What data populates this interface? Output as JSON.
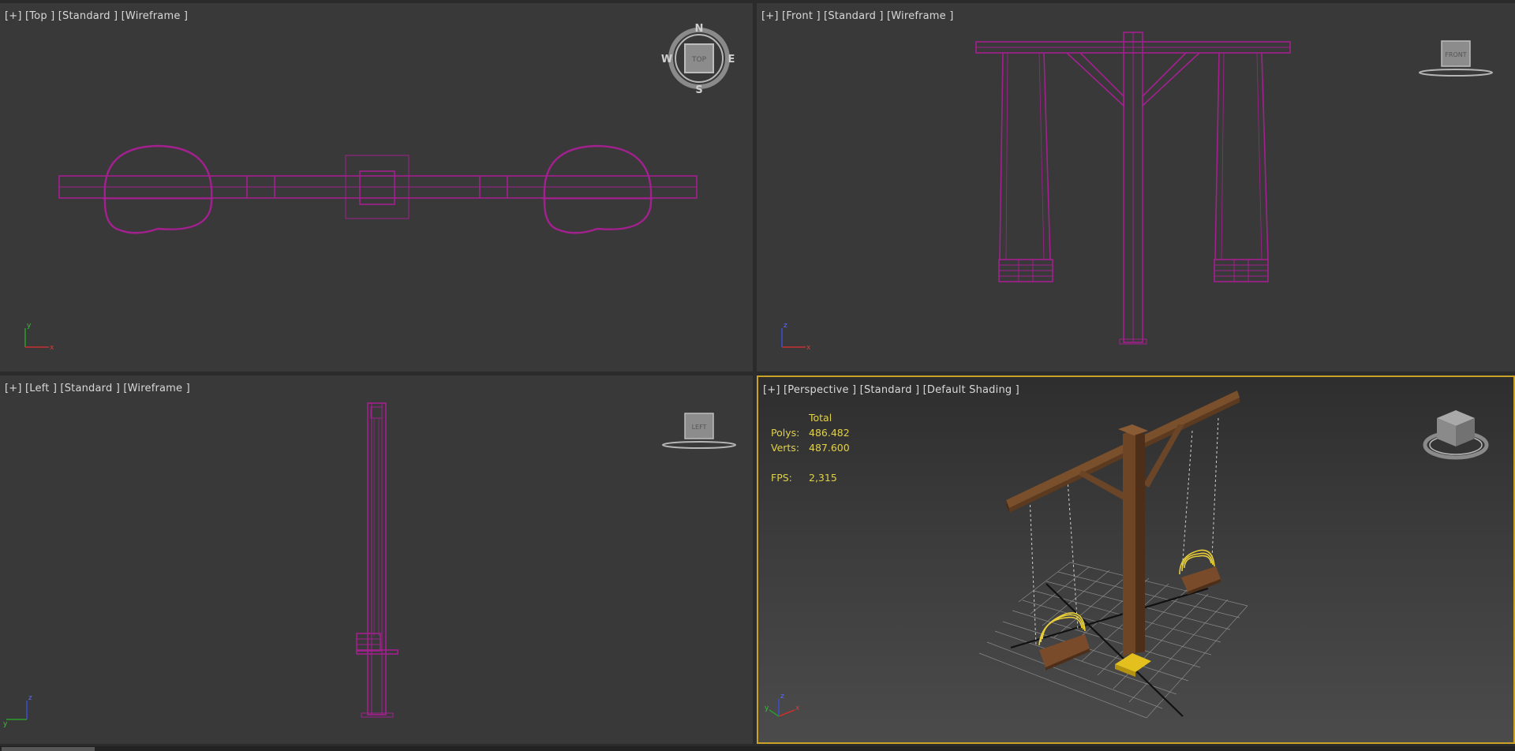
{
  "viewports": {
    "top": {
      "label": "[+] [Top ] [Standard ] [Wireframe ]",
      "cube_text": "TOP",
      "compass": {
        "n": "N",
        "s": "S",
        "e": "E",
        "w": "W"
      }
    },
    "front": {
      "label": "[+] [Front ] [Standard ] [Wireframe ]",
      "cube_text": "FRONT"
    },
    "left": {
      "label": "[+] [Left ] [Standard ] [Wireframe ]",
      "cube_text": "LEFT"
    },
    "perspective": {
      "label": "[+] [Perspective ] [Standard ] [Default Shading ]",
      "stats": {
        "header": "Total",
        "polys_label": "Polys:",
        "polys_value": "486.482",
        "verts_label": "Verts:",
        "verts_value": "487.600",
        "fps_label": "FPS:",
        "fps_value": "2,315"
      }
    }
  },
  "axes": {
    "x": "x",
    "y": "y",
    "z": "z"
  },
  "colors": {
    "wireframe": "#a3208f",
    "viewport_bg": "#393939",
    "active_border": "#c9a227",
    "stats_text": "#e2d14c",
    "wood": "#6b4528",
    "seat_rings": "#e8cf3a"
  }
}
